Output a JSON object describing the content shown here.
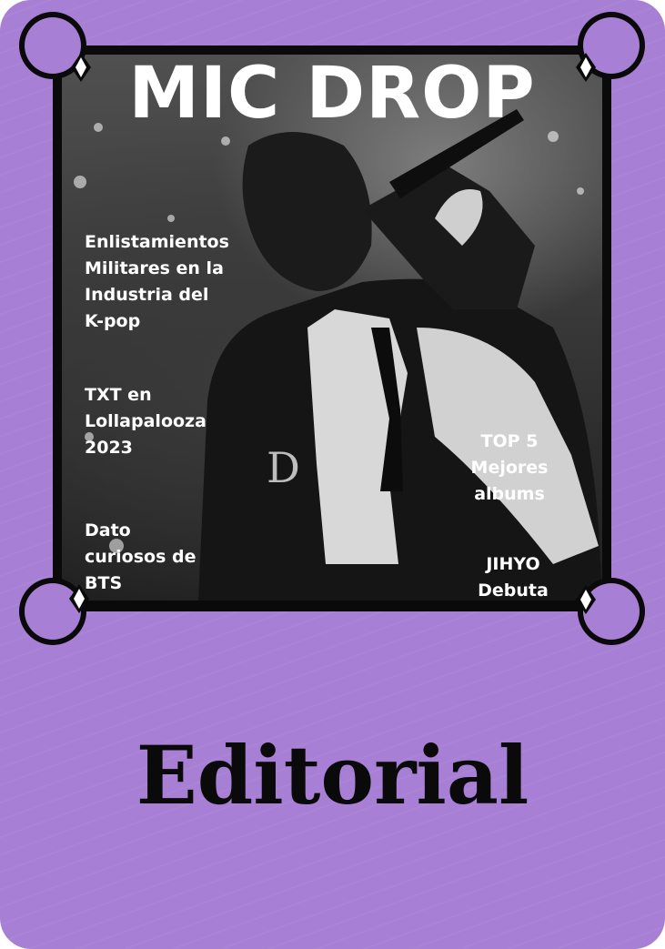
{
  "cover": {
    "masthead": "MIC DROP",
    "coverlines_left": [
      "Enlistamientos Militares en la Industria del K-pop",
      "TXT en Lollapalooza 2023",
      "Dato curiosos de BTS"
    ],
    "coverlines_right": [
      "TOP 5 Mejores albums",
      "JIHYO Debuta c"
    ]
  },
  "title": "Editorial",
  "colors": {
    "background": "#a77fd4",
    "frame": "#0a0a0a",
    "text_light": "#ffffff",
    "text_dark": "#0a0a0a"
  }
}
